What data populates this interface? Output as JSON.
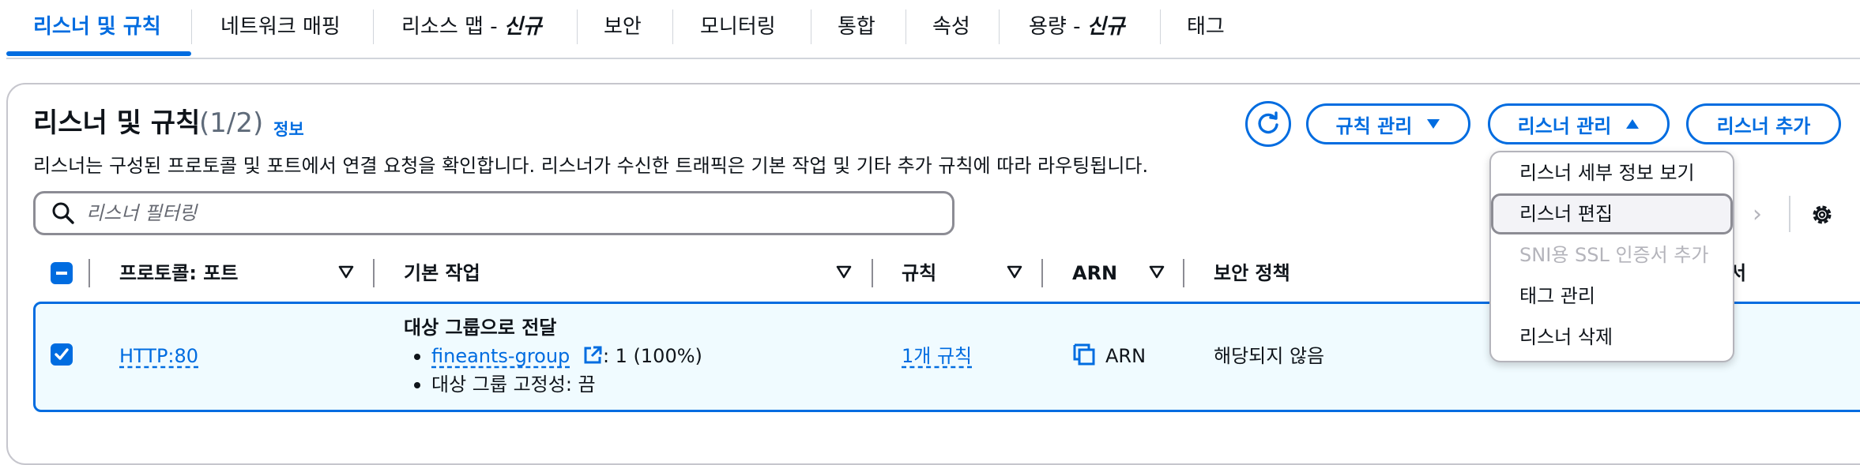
{
  "tabs": [
    {
      "label": "리스너 및 규칙"
    },
    {
      "label": "네트워크 매핑"
    },
    {
      "label": "리소스 맵 - ",
      "badge": "신규"
    },
    {
      "label": "보안"
    },
    {
      "label": "모니터링"
    },
    {
      "label": "통합"
    },
    {
      "label": "속성"
    },
    {
      "label": "용량 - ",
      "badge": "신규"
    },
    {
      "label": "태그"
    }
  ],
  "panel": {
    "title": "리스너 및 규칙",
    "count": "(1/2)",
    "info_link": "정보",
    "description": "리스너는 구성된 프로토콜 및 포트에서 연결 요청을 확인합니다. 리스너가 수신한 트래픽은 기본 작업 및 기타 추가 규칙에 따라 라우팅됩니다."
  },
  "actions": {
    "manage_rules": "규칙 관리",
    "manage_listener": "리스너 관리",
    "add_listener": "리스너 추가"
  },
  "search": {
    "placeholder": "리스너 필터링"
  },
  "menu": {
    "items": [
      {
        "label": "리스너 세부 정보 보기",
        "state": "normal"
      },
      {
        "label": "리스너 편집",
        "state": "hover"
      },
      {
        "label": "SNI용 SSL 인증서 추가",
        "state": "disabled"
      },
      {
        "label": "태그 관리",
        "state": "normal"
      },
      {
        "label": "리스너 삭제",
        "state": "normal"
      }
    ]
  },
  "table": {
    "columns": [
      "프로토콜: 포트",
      "기본 작업",
      "규칙",
      "ARN",
      "보안 정책",
      "서"
    ],
    "rows": [
      {
        "protocol_port": "HTTP:80",
        "action_title": "대상 그룹으로 전달",
        "target_group": "fineants-group",
        "target_weight": ": 1 (100%)",
        "stickiness": "대상 그룹 고정성: 끔",
        "rules": "1개 규칙",
        "arn": "ARN",
        "security_policy": "해당되지 않음"
      }
    ]
  },
  "colors": {
    "accent": "#006ce0",
    "selected_row_bg": "#f0fbff"
  }
}
